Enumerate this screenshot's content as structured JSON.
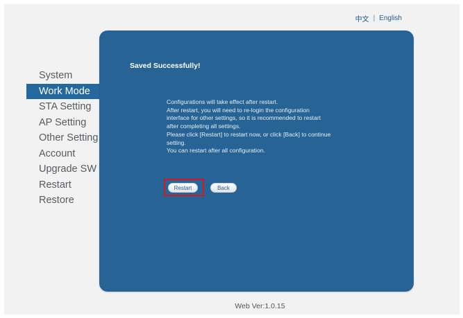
{
  "language": {
    "chinese": "中文",
    "separator": "|",
    "english": "English"
  },
  "sidebar": {
    "items": [
      {
        "label": "System",
        "active": false
      },
      {
        "label": "Work Mode",
        "active": true
      },
      {
        "label": "STA Setting",
        "active": false
      },
      {
        "label": "AP Setting",
        "active": false
      },
      {
        "label": "Other Setting",
        "active": false
      },
      {
        "label": "Account",
        "active": false
      },
      {
        "label": "Upgrade SW",
        "active": false
      },
      {
        "label": "Restart",
        "active": false
      },
      {
        "label": "Restore",
        "active": false
      }
    ]
  },
  "panel": {
    "title": "Saved Successfully!",
    "message_lines": [
      "Configurations will take effect after restart.",
      "After restart, you will need to re-login the configuration",
      "interface for other settings, so it is recommended to restart",
      "after completing all settings.",
      "Please click [Restart] to restart now, or click [Back] to continue",
      "setting.",
      "You can restart after all configuration."
    ],
    "restart_label": "Restart",
    "back_label": "Back"
  },
  "footer": {
    "version": "Web Ver:1.0.15"
  },
  "colors": {
    "panel": "#276495",
    "active_nav": "#24689e",
    "highlight": "#d5181c"
  }
}
